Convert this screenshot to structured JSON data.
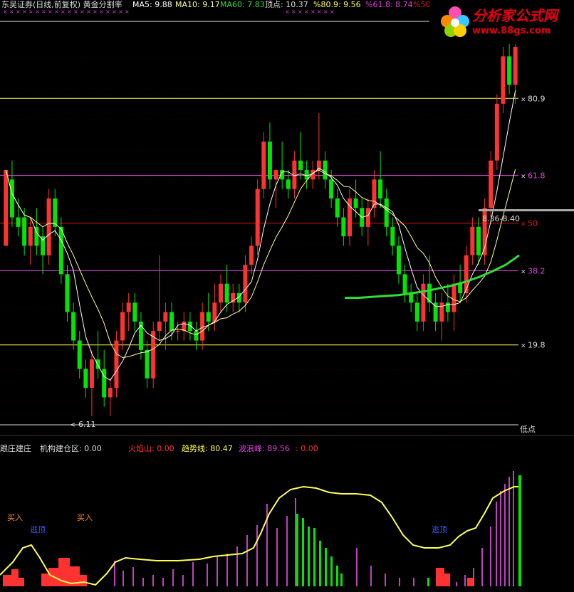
{
  "colors": {
    "bg": "#000000",
    "up": "#ff3232",
    "down": "#00e600",
    "ma5": "#ffffff",
    "ma10": "#ffff96",
    "ma60": "#33dd33",
    "gold": "#ffff55",
    "magenta": "#e040e0",
    "red_line": "#e01818",
    "trend": "#ffff55",
    "wave": "#c040c0"
  },
  "header": {
    "title": "东吴证券(日线,前复权) 黄金分割率",
    "ma5": "MA5: 9.88",
    "ma10": "MA10: 9.17",
    "ma60": "MA60: 7.83",
    "top": "顶点: 10.37",
    "p809": "%80.9: 9.56",
    "p618": "%61.8: 8.74",
    "p50": "%50"
  },
  "sub_header": {
    "zhuang": "跟庄建庄",
    "jigou": "机构建仓区: 0.00",
    "huo": "火焰山: 0.00",
    "trend": "趋势线: 80.47",
    "wave": "波浪峰: 89.56",
    "extra": ": 0.00"
  },
  "logo": {
    "text": "分析家公式网",
    "url": "www.88gs.com"
  },
  "chart_data": {
    "type": "candlestick",
    "fib_levels": [
      {
        "label": "80.9",
        "color": "#ffff55"
      },
      {
        "label": "61.8",
        "color": "#e040e0"
      },
      {
        "label": "50",
        "color": "#e01818"
      },
      {
        "label": "38.2",
        "color": "#e040e0"
      },
      {
        "label": "19.8",
        "color": "#ffff55"
      }
    ],
    "top_label": "顶点",
    "bottom_label": "低点",
    "low_annotation": "6.11",
    "range_annotation": "8.36-8.40",
    "price_range": [
      6.11,
      10.37
    ],
    "candles": [
      [
        8.0,
        8.8,
        8.0,
        8.8
      ],
      [
        8.7,
        8.9,
        8.2,
        8.3
      ],
      [
        8.3,
        8.5,
        8.1,
        8.2
      ],
      [
        8.3,
        8.4,
        7.9,
        8.0
      ],
      [
        8.0,
        8.3,
        7.8,
        8.2
      ],
      [
        8.2,
        8.4,
        7.9,
        8.0
      ],
      [
        8.1,
        8.2,
        7.7,
        7.9
      ],
      [
        7.9,
        8.6,
        7.8,
        8.5
      ],
      [
        8.5,
        8.6,
        8.1,
        8.2
      ],
      [
        8.2,
        8.3,
        7.6,
        7.7
      ],
      [
        7.7,
        7.8,
        7.2,
        7.3
      ],
      [
        7.3,
        7.4,
        6.9,
        7.0
      ],
      [
        7.0,
        7.1,
        6.6,
        6.7
      ],
      [
        6.7,
        6.8,
        6.4,
        6.5
      ],
      [
        6.5,
        6.9,
        6.2,
        6.8
      ],
      [
        6.8,
        7.1,
        6.6,
        6.7
      ],
      [
        6.7,
        6.9,
        6.3,
        6.4
      ],
      [
        6.4,
        6.6,
        6.2,
        6.5
      ],
      [
        6.5,
        7.1,
        6.4,
        7.0
      ],
      [
        7.0,
        7.4,
        6.9,
        7.3
      ],
      [
        7.3,
        7.5,
        7.1,
        7.4
      ],
      [
        7.4,
        7.5,
        7.1,
        7.2
      ],
      [
        7.2,
        7.3,
        6.8,
        6.9
      ],
      [
        6.9,
        7.0,
        6.5,
        6.6
      ],
      [
        6.6,
        7.2,
        6.5,
        7.1
      ],
      [
        7.1,
        7.9,
        7.0,
        7.2
      ],
      [
        7.2,
        7.4,
        6.9,
        7.3
      ],
      [
        7.3,
        7.4,
        7.0,
        7.1
      ],
      [
        7.1,
        7.2,
        7.0,
        7.1
      ],
      [
        7.1,
        7.3,
        7.0,
        7.2
      ],
      [
        7.2,
        7.3,
        7.0,
        7.1
      ],
      [
        7.1,
        7.2,
        6.9,
        7.0
      ],
      [
        7.0,
        7.4,
        6.9,
        7.3
      ],
      [
        7.3,
        7.5,
        7.1,
        7.2
      ],
      [
        7.2,
        7.6,
        7.1,
        7.4
      ],
      [
        7.4,
        7.7,
        7.3,
        7.6
      ],
      [
        7.6,
        7.8,
        7.3,
        7.4
      ],
      [
        7.4,
        7.6,
        7.3,
        7.5
      ],
      [
        7.5,
        7.6,
        7.3,
        7.4
      ],
      [
        7.4,
        7.9,
        7.3,
        7.8
      ],
      [
        7.8,
        8.1,
        7.7,
        8.0
      ],
      [
        8.0,
        8.7,
        7.9,
        8.6
      ],
      [
        8.6,
        9.2,
        8.5,
        9.1
      ],
      [
        9.1,
        9.3,
        8.6,
        8.7
      ],
      [
        8.7,
        8.8,
        8.4,
        8.8
      ],
      [
        8.8,
        9.1,
        8.6,
        8.7
      ],
      [
        8.7,
        8.8,
        8.5,
        8.6
      ],
      [
        8.6,
        9.0,
        8.5,
        8.9
      ],
      [
        8.9,
        9.2,
        8.7,
        8.8
      ],
      [
        8.8,
        8.9,
        8.6,
        8.7
      ],
      [
        8.7,
        8.9,
        8.6,
        8.8
      ],
      [
        8.8,
        9.4,
        8.7,
        8.9
      ],
      [
        8.9,
        9.0,
        8.6,
        8.7
      ],
      [
        8.7,
        8.8,
        8.4,
        8.5
      ],
      [
        8.5,
        8.6,
        8.2,
        8.3
      ],
      [
        8.3,
        8.4,
        8.0,
        8.1
      ],
      [
        8.1,
        8.6,
        8.0,
        8.5
      ],
      [
        8.5,
        8.7,
        8.3,
        8.4
      ],
      [
        8.4,
        8.5,
        8.1,
        8.2
      ],
      [
        8.2,
        8.5,
        8.0,
        8.4
      ],
      [
        8.4,
        8.8,
        8.3,
        8.7
      ],
      [
        8.7,
        9.0,
        8.4,
        8.5
      ],
      [
        8.5,
        8.6,
        8.1,
        8.2
      ],
      [
        8.2,
        8.3,
        7.9,
        8.0
      ],
      [
        8.0,
        8.1,
        7.6,
        7.7
      ],
      [
        7.7,
        7.8,
        7.4,
        7.5
      ],
      [
        7.5,
        7.6,
        7.3,
        7.4
      ],
      [
        7.4,
        7.5,
        7.1,
        7.2
      ],
      [
        7.2,
        7.7,
        7.1,
        7.6
      ],
      [
        7.6,
        7.9,
        7.3,
        7.4
      ],
      [
        7.4,
        7.5,
        7.1,
        7.2
      ],
      [
        7.2,
        7.5,
        7.0,
        7.4
      ],
      [
        7.4,
        7.6,
        7.2,
        7.3
      ],
      [
        7.3,
        7.7,
        7.1,
        7.6
      ],
      [
        7.6,
        7.8,
        7.4,
        7.5
      ],
      [
        7.5,
        8.0,
        7.4,
        7.9
      ],
      [
        7.9,
        8.3,
        7.8,
        8.2
      ],
      [
        8.2,
        8.3,
        7.8,
        7.9
      ],
      [
        7.9,
        8.5,
        7.8,
        8.4
      ],
      [
        8.4,
        9.0,
        8.3,
        8.9
      ],
      [
        8.9,
        9.6,
        8.8,
        9.5
      ],
      [
        9.5,
        10.1,
        9.4,
        10.0
      ],
      [
        10.0,
        10.37,
        9.6,
        9.7
      ],
      [
        9.7,
        10.2,
        9.5,
        10.1
      ]
    ],
    "ma60": [
      7.45,
      7.45,
      7.46,
      7.47,
      7.48,
      7.5,
      7.52,
      7.55,
      7.58,
      7.62,
      7.67,
      7.73,
      7.8,
      7.9
    ]
  }
}
